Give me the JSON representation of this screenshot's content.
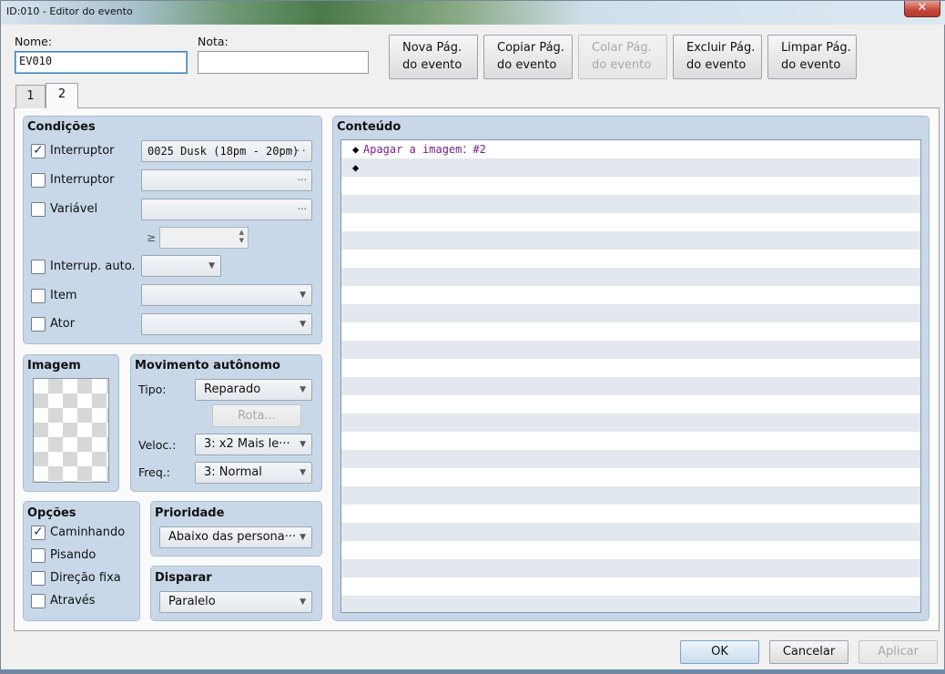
{
  "window": {
    "title": "ID:010 - Editor do evento",
    "close_glyph": "✕"
  },
  "top": {
    "name_label": "Nome:",
    "name_value": "EV010",
    "note_label": "Nota:",
    "note_value": "",
    "buttons": [
      {
        "line1": "Nova Pág.",
        "line2": "do evento",
        "enabled": true
      },
      {
        "line1": "Copiar Pág.",
        "line2": "do evento",
        "enabled": true
      },
      {
        "line1": "Colar Pág.",
        "line2": "do evento",
        "enabled": false
      },
      {
        "line1": "Excluir Pág.",
        "line2": "do evento",
        "enabled": true
      },
      {
        "line1": "Limpar Pág.",
        "line2": "do evento",
        "enabled": true
      }
    ]
  },
  "tabs": [
    {
      "label": "1"
    },
    {
      "label": "2",
      "active": true
    }
  ],
  "conditions": {
    "title": "Condições",
    "switch1": {
      "label": "Interruptor",
      "checked": true,
      "value": "0025 Dusk (18pm - 20pm)",
      "dots": "···"
    },
    "switch2": {
      "label": "Interruptor",
      "checked": false,
      "value": "",
      "dots": "···"
    },
    "variable": {
      "label": "Variável",
      "checked": false,
      "value": "",
      "dots": "···"
    },
    "ge_symbol": "≥",
    "self_switch": {
      "label": "Interrup. auto.",
      "checked": false
    },
    "item": {
      "label": "Item",
      "checked": false
    },
    "actor": {
      "label": "Ator",
      "checked": false
    }
  },
  "image": {
    "title": "Imagem"
  },
  "movement": {
    "title": "Movimento autônomo",
    "type_label": "Tipo:",
    "type_value": "Reparado",
    "route_label": "Rota...",
    "speed_label": "Veloc.:",
    "speed_value": "3: x2 Mais le···",
    "freq_label": "Freq.:",
    "freq_value": "3: Normal"
  },
  "options": {
    "title": "Opções",
    "items": [
      {
        "label": "Caminhando",
        "checked": true
      },
      {
        "label": "Pisando",
        "checked": false
      },
      {
        "label": "Direção fixa",
        "checked": false
      },
      {
        "label": "Através",
        "checked": false
      }
    ]
  },
  "priority": {
    "title": "Prioridade",
    "value": "Abaixo das persona···"
  },
  "trigger": {
    "title": "Disparar",
    "value": "Paralelo"
  },
  "content": {
    "title": "Conteúdo",
    "commands": [
      {
        "marker": "◆",
        "text": "Apagar a imagem：#2"
      },
      {
        "marker": "◆",
        "text": ""
      }
    ]
  },
  "footer": {
    "ok": "OK",
    "cancel": "Cancelar",
    "apply": "Aplicar"
  },
  "icons": {
    "check": "✓",
    "dropdown": "▼",
    "spin_up": "▲",
    "spin_down": "▼"
  },
  "colors": {
    "panel": "#c9d8e8",
    "command_text": "#7a1f8a",
    "row_alt": "#e3e8ee"
  }
}
